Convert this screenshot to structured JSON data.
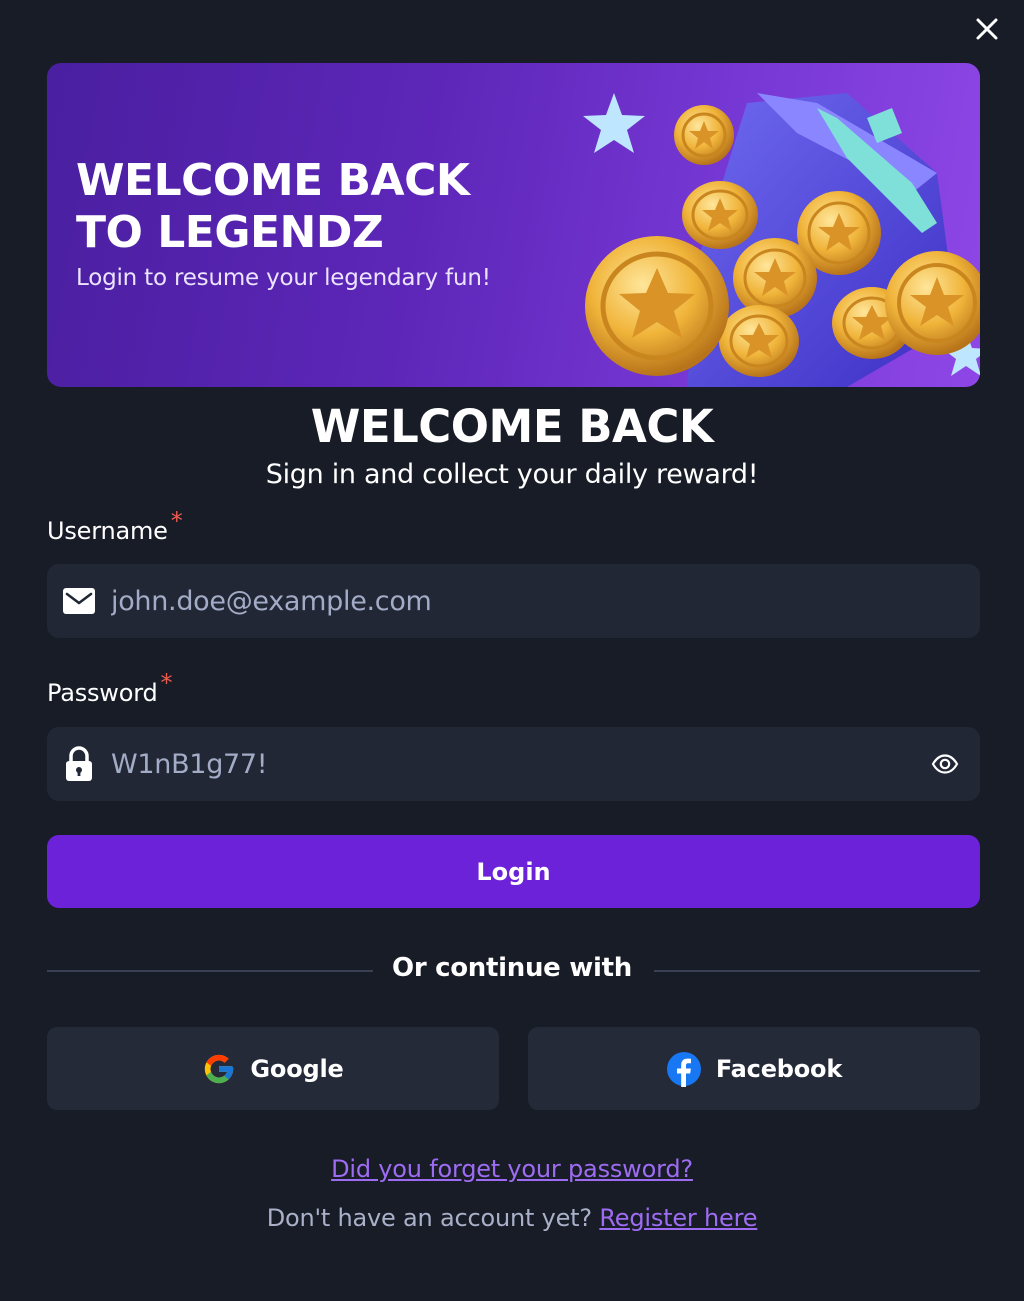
{
  "banner": {
    "title": "WELCOME BACK\nTO LEGENDZ",
    "subtitle": "Login to resume your legendary fun!"
  },
  "heading": "WELCOME BACK",
  "subheading": "Sign in and collect your daily reward!",
  "username": {
    "label": "Username",
    "required_mark": "*",
    "value": "john.doe@example.com",
    "icon": "mail-icon"
  },
  "password": {
    "label": "Password",
    "required_mark": "*",
    "value": "W1nB1g77!",
    "icon": "lock-icon",
    "toggle_icon": "eye-icon"
  },
  "login_button": "Login",
  "divider_text": "Or continue with",
  "social": {
    "google": "Google",
    "facebook": "Facebook"
  },
  "forgot_link": "Did you forget your password?",
  "register": {
    "prompt": "Don't have an account yet?",
    "link": "Register here"
  },
  "colors": {
    "background": "#181c27",
    "accent": "#6c22d8",
    "link": "#9e6cf2",
    "required": "#ef5b4f"
  }
}
